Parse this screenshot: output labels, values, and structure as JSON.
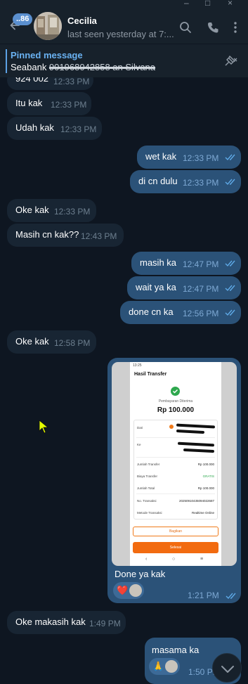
{
  "window": {
    "controls": [
      "–",
      "□",
      "×"
    ]
  },
  "header": {
    "unread_badge": "..86",
    "contact_name": "Cecilia",
    "status": "last seen yesterday at 7:...",
    "icons": [
      "back-arrow-icon",
      "search-icon",
      "phone-icon",
      "more-vertical-icon"
    ]
  },
  "pinned": {
    "title": "Pinned message",
    "text_prefix": "Seabank ",
    "text_redacted": "901968042858 an Silvana",
    "icon": "unpin-icon"
  },
  "messages": [
    {
      "dir": "in",
      "text": "924 002",
      "time": "12:33 PM"
    },
    {
      "dir": "in",
      "text": "Itu kak",
      "time": "12:33 PM"
    },
    {
      "dir": "in",
      "text": "Udah kak",
      "time": "12:33 PM"
    },
    {
      "dir": "out",
      "text": "wet kak",
      "time": "12:33 PM"
    },
    {
      "dir": "out",
      "text": "di cn dulu",
      "time": "12:33 PM"
    },
    {
      "dir": "in",
      "text": "Oke kak",
      "time": "12:33 PM"
    },
    {
      "dir": "in",
      "text": "Masih cn kak??",
      "time": "12:43 PM"
    },
    {
      "dir": "out",
      "text": "masih ka",
      "time": "12:47 PM"
    },
    {
      "dir": "out",
      "text": "wait ya ka",
      "time": "12:47 PM"
    },
    {
      "dir": "out",
      "text": "done cn ka",
      "time": "12:56 PM"
    },
    {
      "dir": "in",
      "text": "Oke kak",
      "time": "12:58 PM"
    },
    {
      "dir": "out",
      "text": "Done ya kak",
      "time": "1:21 PM",
      "reaction": "❤️"
    },
    {
      "dir": "in",
      "text": "Oke makasih kak",
      "time": "1:49 PM"
    },
    {
      "dir": "out",
      "text": "masama ka",
      "time": "1:50 PM",
      "reaction": "🙏"
    }
  ],
  "receipt": {
    "status_time": "13:25",
    "title": "Hasil Transfer",
    "received": "Pembayaran Diterima",
    "amount": "Rp 100.000",
    "from_label": "Dari",
    "to_label": "Ke",
    "rows": [
      {
        "label": "Jumlah Transfer",
        "value": "Rp 100.000"
      },
      {
        "label": "Biaya Transfer",
        "value": "GRATIS"
      },
      {
        "label": "Jumlah Total",
        "value": "Rp 100.000"
      },
      {
        "label": "No. Transaksi",
        "value": "20250910435094022687"
      },
      {
        "label": "Metode Transaksi",
        "value": "Realtime Online"
      }
    ],
    "share_button": "Bagikan",
    "done_button": "Selesai",
    "nav": [
      "‹",
      "○",
      "≡"
    ]
  },
  "colors": {
    "background": "#0e1621",
    "header": "#17212b",
    "incoming_bubble": "#182533",
    "outgoing_bubble": "#2b5278",
    "accent": "#6ab2f2",
    "tick": "#5ea9e6"
  }
}
